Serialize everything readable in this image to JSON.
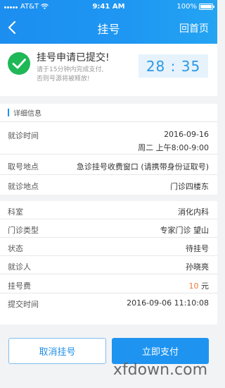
{
  "status_bar": {
    "carrier": "AT&T",
    "time": "9:41 AM",
    "battery": "100%"
  },
  "nav": {
    "title": "挂号",
    "home_label": "回首页"
  },
  "submit": {
    "title": "挂号申请已提交!",
    "hint_line1": "请于15分钟内完成支付,",
    "hint_line2": "否则号源将被释放!",
    "countdown": "28 : 35"
  },
  "detail": {
    "section_title": "详细信息",
    "rows": [
      {
        "label": "就诊时间",
        "value": "2016-09-16",
        "value2": "周二 上午8:00-9:00"
      },
      {
        "label": "取号地点",
        "value": "急诊挂号收费窗口 (请携带身份证取号)"
      },
      {
        "label": "就诊地点",
        "value": "门诊四楼东"
      },
      {
        "label": "科室",
        "value": "消化内科"
      },
      {
        "label": "门诊类型",
        "value": "专家门诊  望山"
      },
      {
        "label": "状态",
        "value": "待挂号"
      },
      {
        "label": "就诊人",
        "value": "孙晓亮"
      },
      {
        "label": "挂号费",
        "value_amount": "10",
        "value_unit": " 元"
      },
      {
        "label": "提交时间",
        "value": "2016-09-06  11:10:08"
      }
    ]
  },
  "actions": {
    "cancel_label": "取消挂号",
    "pay_label": "立即支付"
  },
  "watermark": "xfdown.com",
  "colors": {
    "primary": "#1e94f0",
    "success": "#1fb857",
    "fee": "#f07a3a",
    "timer_bg": "#e6f3fc"
  },
  "icons": [
    "signal-icon",
    "wifi-icon",
    "battery-icon",
    "back-arrow-icon",
    "check-circle-icon"
  ]
}
